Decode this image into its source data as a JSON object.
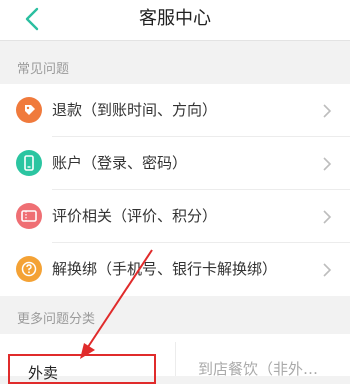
{
  "header": {
    "title": "客服中心"
  },
  "sections": {
    "common": "常见问题",
    "more": "更多问题分类"
  },
  "common_items": [
    {
      "label": "退款（到账时间、方向）",
      "icon": "refund-tag-icon",
      "color": "#f07a3c"
    },
    {
      "label": "账户（登录、密码）",
      "icon": "phone-account-icon",
      "color": "#2bc5a1"
    },
    {
      "label": "评价相关（评价、积分）",
      "icon": "ticket-review-icon",
      "color": "#ef6f74"
    },
    {
      "label": "解换绑（手机号、银行卡解换绑）",
      "icon": "question-icon",
      "color": "#f4a235"
    }
  ],
  "categories": {
    "left": "外卖",
    "right": "到店餐饮（非外…"
  },
  "colors": {
    "accent": "#2bbfa0",
    "highlight": "#e02b2b"
  }
}
